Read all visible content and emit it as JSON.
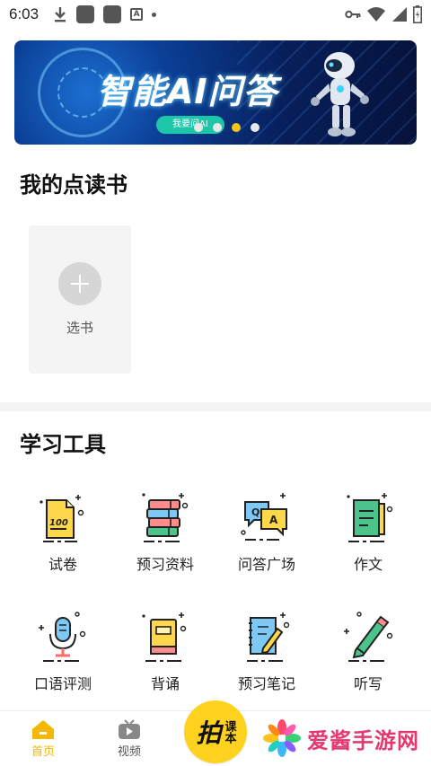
{
  "status_bar": {
    "time": "6:03"
  },
  "banner": {
    "title": "智能AI问答",
    "button_label": "我要问AI",
    "indicator_count": 4,
    "active_indicator": 3
  },
  "my_books": {
    "title": "我的点读书",
    "select_label": "选书"
  },
  "study_tools": {
    "title": "学习工具",
    "items": [
      {
        "label": "试卷",
        "icon": "exam-paper-icon"
      },
      {
        "label": "预习资料",
        "icon": "books-stack-icon"
      },
      {
        "label": "问答广场",
        "icon": "qa-bubbles-icon"
      },
      {
        "label": "作文",
        "icon": "composition-doc-icon"
      },
      {
        "label": "口语评测",
        "icon": "microphone-icon"
      },
      {
        "label": "背诵",
        "icon": "book-icon"
      },
      {
        "label": "预习笔记",
        "icon": "notebook-pencil-icon"
      },
      {
        "label": "听写",
        "icon": "pencil-icon"
      }
    ]
  },
  "bottom_nav": {
    "home_label": "首页",
    "video_label": "视频",
    "center_main": "拍",
    "center_sub": "课本"
  },
  "watermark": {
    "text": "爱酱手游网"
  },
  "colors": {
    "accent": "#f5b800",
    "banner_bg": "#0b3f96",
    "card_bg": "#f4f4f4"
  }
}
